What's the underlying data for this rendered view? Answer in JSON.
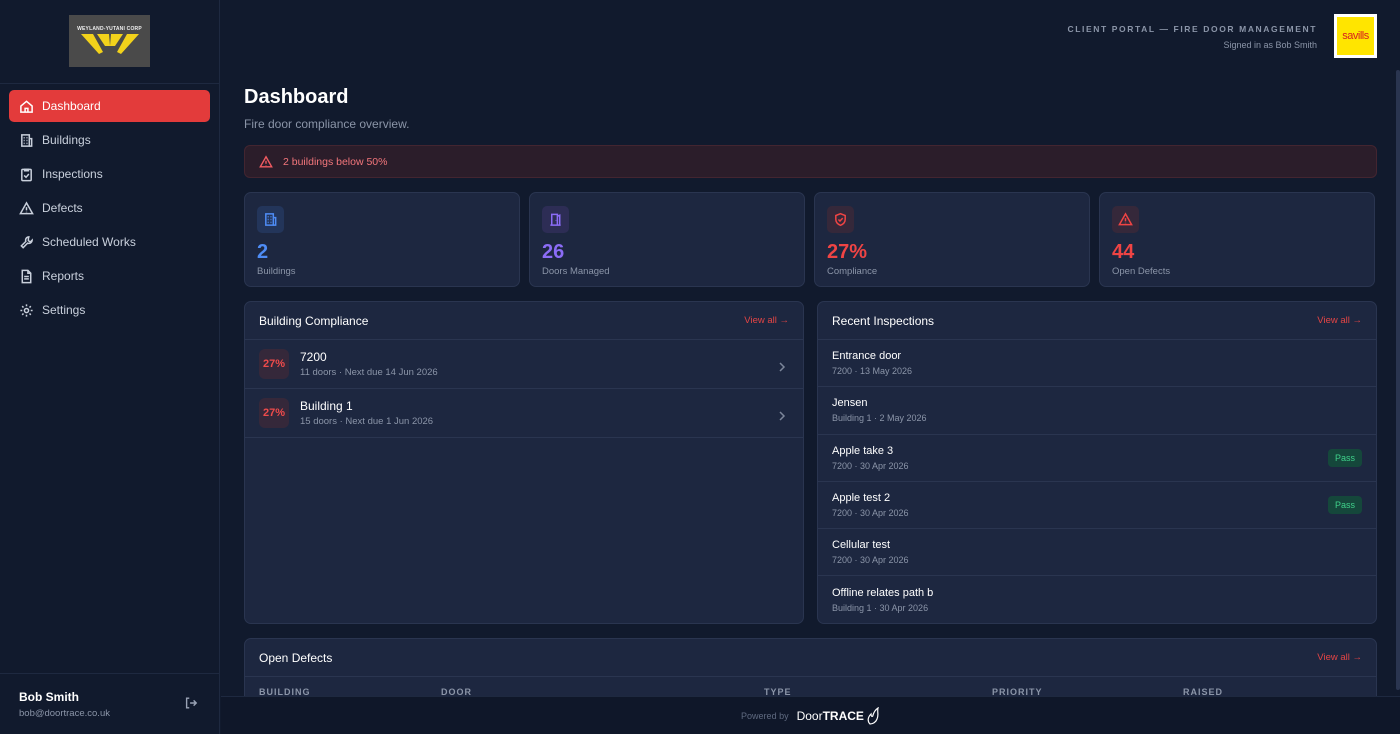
{
  "sidebar": {
    "logo_text": "WEYLAND-YUTANI CORP",
    "items": [
      {
        "label": "Dashboard",
        "icon": "home-icon",
        "active": true
      },
      {
        "label": "Buildings",
        "icon": "building-icon"
      },
      {
        "label": "Inspections",
        "icon": "clipboard-check-icon"
      },
      {
        "label": "Defects",
        "icon": "warning-icon"
      },
      {
        "label": "Scheduled Works",
        "icon": "wrench-icon"
      },
      {
        "label": "Reports",
        "icon": "document-icon"
      },
      {
        "label": "Settings",
        "icon": "gear-icon"
      }
    ],
    "user": {
      "name": "Bob Smith",
      "email": "bob@doortrace.co.uk"
    }
  },
  "header": {
    "portal_title": "CLIENT PORTAL — FIRE DOOR MANAGEMENT",
    "signed_in": "Signed in as Bob Smith",
    "client_logo_text": "savills"
  },
  "page": {
    "title": "Dashboard",
    "subtitle": "Fire door compliance overview.",
    "alert": "2 buildings below 50%"
  },
  "stats": [
    {
      "value": "2",
      "label": "Buildings",
      "color": "#4e8cf5",
      "bg": "#23355a"
    },
    {
      "value": "26",
      "label": "Doors Managed",
      "color": "#8b6cf6",
      "bg": "#2d2d55"
    },
    {
      "value": "27%",
      "label": "Compliance",
      "color": "#ef4444",
      "bg": "#35283a"
    },
    {
      "value": "44",
      "label": "Open Defects",
      "color": "#ef4444",
      "bg": "#35283a"
    }
  ],
  "compliance": {
    "title": "Building Compliance",
    "view_all": "View all →",
    "rows": [
      {
        "pct": "27%",
        "name": "7200",
        "meta": "11 doors · Next due 14 Jun 2026"
      },
      {
        "pct": "27%",
        "name": "Building 1",
        "meta": "15 doors · Next due 1 Jun 2026"
      }
    ]
  },
  "inspections": {
    "title": "Recent Inspections",
    "view_all": "View all →",
    "rows": [
      {
        "name": "Entrance door",
        "meta": "7200 · 13 May 2026",
        "badge": ""
      },
      {
        "name": "Jensen",
        "meta": "Building 1 · 2 May 2026",
        "badge": ""
      },
      {
        "name": "Apple take 3",
        "meta": "7200 · 30 Apr 2026",
        "badge": "Pass"
      },
      {
        "name": "Apple test 2",
        "meta": "7200 · 30 Apr 2026",
        "badge": "Pass"
      },
      {
        "name": "Cellular test",
        "meta": "7200 · 30 Apr 2026",
        "badge": ""
      },
      {
        "name": "Offline relates path b",
        "meta": "Building 1 · 30 Apr 2026",
        "badge": ""
      }
    ]
  },
  "defects": {
    "title": "Open Defects",
    "view_all": "View all →",
    "columns": [
      "BUILDING",
      "DOOR",
      "TYPE",
      "PRIORITY",
      "RAISED"
    ]
  },
  "footer": {
    "powered_by": "Powered by",
    "brand_a": "Door",
    "brand_b": "TRACE"
  }
}
